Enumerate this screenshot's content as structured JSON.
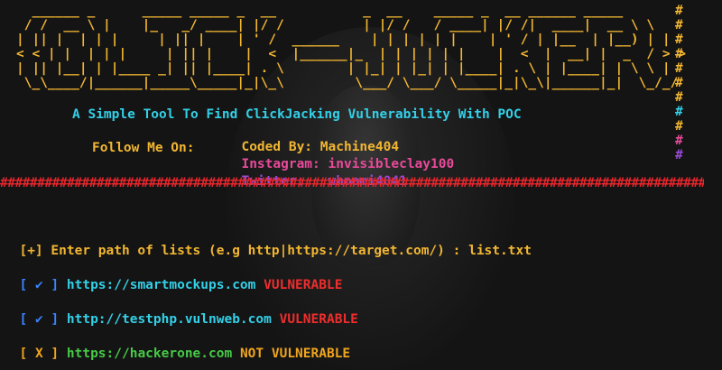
{
  "banner": {
    "ascii_art": "  ______ _      _____ _____ _  __           _  __    _____ _  __ ______ _____\n / /  __ \\ |    |_   _/ ____| |/ /          | |/ /   / ____| |/ /|  ____|  __ \\ \\\n| || |  | | |     | || |    | ' /  ______    | | | | | |    | ' / | |__  | |__) | |\n< < | |  | | |     | || |    |  <  |______|_  | | | | | |    |  <  |  __| |  _  / > >\n| || |__| | |____ _| || |____| . \\        | |_| | |_| | |____| . \\ | |____| | \\ \\ |\n \\_\\____/|______|_____\\_____|_|\\_\\         \\___/ \\___/ \\_____|_|\\_\\|______|_|  \\_/_/",
    "hash_column": [
      "#",
      "#",
      "#",
      "#",
      "#",
      "#",
      "#",
      "#",
      "#",
      "#",
      "#"
    ],
    "tagline": "A Simple Tool To Find ClickJacking Vulnerability With POC",
    "coded_by_label": "Coded By:",
    "coded_by_value": "Machine404",
    "follow_label": "Follow Me On:",
    "instagram_label": "Instagram:",
    "instagram_value": "invisibleclay100",
    "twitter_label": "Twitter:",
    "twitter_value": "whoami4041",
    "divider": "##################################################################################################"
  },
  "prompt": {
    "marker": "[+]",
    "text": "Enter path of lists (e.g http|https://target.com/) :",
    "input_value": "list.txt"
  },
  "results": [
    {
      "open": "[",
      "mark": "✔",
      "close": "]",
      "url": "https://smartmockups.com",
      "status": "VULNERABLE"
    },
    {
      "open": "[",
      "mark": "✔",
      "close": "]",
      "url": "http://testphp.vulnweb.com",
      "status": "VULNERABLE"
    },
    {
      "open": "[",
      "mark": "X",
      "close": "]",
      "url": "https://hackerone.com",
      "status": "NOT VULNERABLE"
    }
  ],
  "colors": {
    "background": "#141414",
    "banner": "#f2b632",
    "tagline": "#33d0e8",
    "instagram": "#e84a9a",
    "twitter": "#9a4ad8",
    "divider": "#e8262c",
    "vulnerable": "#ef2d2d",
    "not_vulnerable": "#f0a51e",
    "safe_url": "#46c946"
  }
}
